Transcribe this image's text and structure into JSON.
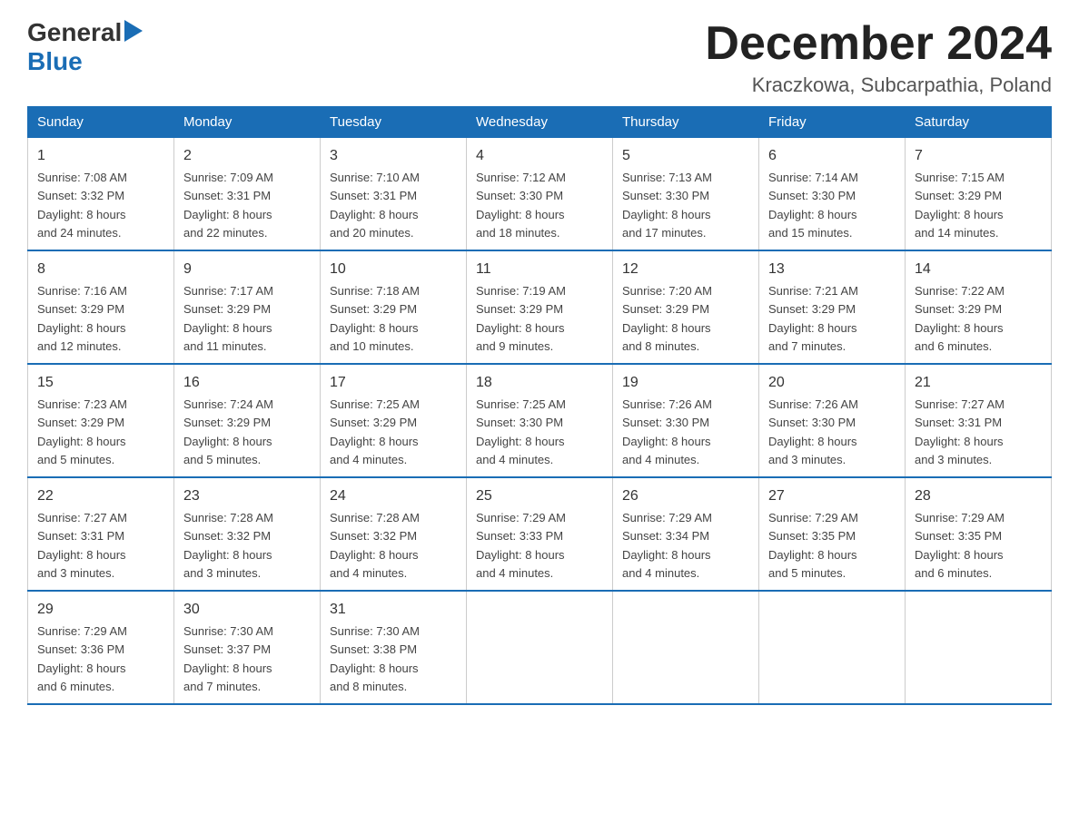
{
  "header": {
    "logo_general": "General",
    "logo_blue": "Blue",
    "title": "December 2024",
    "subtitle": "Kraczkowa, Subcarpathia, Poland"
  },
  "columns": [
    "Sunday",
    "Monday",
    "Tuesday",
    "Wednesday",
    "Thursday",
    "Friday",
    "Saturday"
  ],
  "weeks": [
    [
      {
        "day": "1",
        "sunrise": "7:08 AM",
        "sunset": "3:32 PM",
        "daylight": "8 hours and 24 minutes."
      },
      {
        "day": "2",
        "sunrise": "7:09 AM",
        "sunset": "3:31 PM",
        "daylight": "8 hours and 22 minutes."
      },
      {
        "day": "3",
        "sunrise": "7:10 AM",
        "sunset": "3:31 PM",
        "daylight": "8 hours and 20 minutes."
      },
      {
        "day": "4",
        "sunrise": "7:12 AM",
        "sunset": "3:30 PM",
        "daylight": "8 hours and 18 minutes."
      },
      {
        "day": "5",
        "sunrise": "7:13 AM",
        "sunset": "3:30 PM",
        "daylight": "8 hours and 17 minutes."
      },
      {
        "day": "6",
        "sunrise": "7:14 AM",
        "sunset": "3:30 PM",
        "daylight": "8 hours and 15 minutes."
      },
      {
        "day": "7",
        "sunrise": "7:15 AM",
        "sunset": "3:29 PM",
        "daylight": "8 hours and 14 minutes."
      }
    ],
    [
      {
        "day": "8",
        "sunrise": "7:16 AM",
        "sunset": "3:29 PM",
        "daylight": "8 hours and 12 minutes."
      },
      {
        "day": "9",
        "sunrise": "7:17 AM",
        "sunset": "3:29 PM",
        "daylight": "8 hours and 11 minutes."
      },
      {
        "day": "10",
        "sunrise": "7:18 AM",
        "sunset": "3:29 PM",
        "daylight": "8 hours and 10 minutes."
      },
      {
        "day": "11",
        "sunrise": "7:19 AM",
        "sunset": "3:29 PM",
        "daylight": "8 hours and 9 minutes."
      },
      {
        "day": "12",
        "sunrise": "7:20 AM",
        "sunset": "3:29 PM",
        "daylight": "8 hours and 8 minutes."
      },
      {
        "day": "13",
        "sunrise": "7:21 AM",
        "sunset": "3:29 PM",
        "daylight": "8 hours and 7 minutes."
      },
      {
        "day": "14",
        "sunrise": "7:22 AM",
        "sunset": "3:29 PM",
        "daylight": "8 hours and 6 minutes."
      }
    ],
    [
      {
        "day": "15",
        "sunrise": "7:23 AM",
        "sunset": "3:29 PM",
        "daylight": "8 hours and 5 minutes."
      },
      {
        "day": "16",
        "sunrise": "7:24 AM",
        "sunset": "3:29 PM",
        "daylight": "8 hours and 5 minutes."
      },
      {
        "day": "17",
        "sunrise": "7:25 AM",
        "sunset": "3:29 PM",
        "daylight": "8 hours and 4 minutes."
      },
      {
        "day": "18",
        "sunrise": "7:25 AM",
        "sunset": "3:30 PM",
        "daylight": "8 hours and 4 minutes."
      },
      {
        "day": "19",
        "sunrise": "7:26 AM",
        "sunset": "3:30 PM",
        "daylight": "8 hours and 4 minutes."
      },
      {
        "day": "20",
        "sunrise": "7:26 AM",
        "sunset": "3:30 PM",
        "daylight": "8 hours and 3 minutes."
      },
      {
        "day": "21",
        "sunrise": "7:27 AM",
        "sunset": "3:31 PM",
        "daylight": "8 hours and 3 minutes."
      }
    ],
    [
      {
        "day": "22",
        "sunrise": "7:27 AM",
        "sunset": "3:31 PM",
        "daylight": "8 hours and 3 minutes."
      },
      {
        "day": "23",
        "sunrise": "7:28 AM",
        "sunset": "3:32 PM",
        "daylight": "8 hours and 3 minutes."
      },
      {
        "day": "24",
        "sunrise": "7:28 AM",
        "sunset": "3:32 PM",
        "daylight": "8 hours and 4 minutes."
      },
      {
        "day": "25",
        "sunrise": "7:29 AM",
        "sunset": "3:33 PM",
        "daylight": "8 hours and 4 minutes."
      },
      {
        "day": "26",
        "sunrise": "7:29 AM",
        "sunset": "3:34 PM",
        "daylight": "8 hours and 4 minutes."
      },
      {
        "day": "27",
        "sunrise": "7:29 AM",
        "sunset": "3:35 PM",
        "daylight": "8 hours and 5 minutes."
      },
      {
        "day": "28",
        "sunrise": "7:29 AM",
        "sunset": "3:35 PM",
        "daylight": "8 hours and 6 minutes."
      }
    ],
    [
      {
        "day": "29",
        "sunrise": "7:29 AM",
        "sunset": "3:36 PM",
        "daylight": "8 hours and 6 minutes."
      },
      {
        "day": "30",
        "sunrise": "7:30 AM",
        "sunset": "3:37 PM",
        "daylight": "8 hours and 7 minutes."
      },
      {
        "day": "31",
        "sunrise": "7:30 AM",
        "sunset": "3:38 PM",
        "daylight": "8 hours and 8 minutes."
      },
      null,
      null,
      null,
      null
    ]
  ],
  "labels": {
    "sunrise_prefix": "Sunrise: ",
    "sunset_prefix": "Sunset: ",
    "daylight_prefix": "Daylight: "
  }
}
